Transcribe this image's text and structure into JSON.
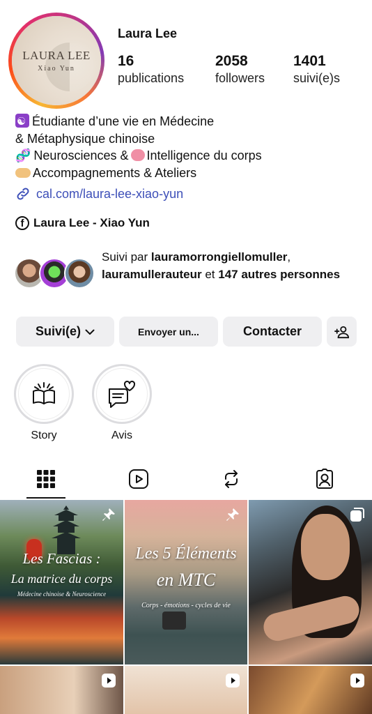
{
  "profile": {
    "name": "Laura Lee",
    "avatar_text": "LAURA LEE",
    "avatar_subtext": "Xiao Yun"
  },
  "stats": [
    {
      "value": "16",
      "label": "publications"
    },
    {
      "value": "2058",
      "label": "followers"
    },
    {
      "value": "1401",
      "label": "suivi(e)s"
    }
  ],
  "bio": {
    "line1": "Étudiante d’une vie en Médecine",
    "line2": "& Métaphysique chinoise",
    "line3a": "Neurosciences &",
    "line3b": "Intelligence du corps",
    "line4": "Accompagnements & Ateliers"
  },
  "link": {
    "text": "cal.com/laura-lee-xiao-yun"
  },
  "facebook": {
    "text": "Laura Lee - Xiao Yun"
  },
  "followed_by": {
    "prefix": "Suivi par",
    "user1": "lauramorrongiellomuller",
    "user2": "lauramullerauteur",
    "middle": "et",
    "others": "147 autres personnes"
  },
  "buttons": {
    "follow": "Suivi(e)",
    "message": "Envoyer un...",
    "contact": "Contacter"
  },
  "highlights": [
    {
      "label": "Story",
      "icon": "open-book-icon"
    },
    {
      "label": "Avis",
      "icon": "speech-heart-icon"
    }
  ],
  "tabs": [
    "grid-icon",
    "reels-icon",
    "reposts-icon",
    "tagged-icon"
  ],
  "posts": [
    {
      "title1": "Les Fascias :",
      "title2": "La matrice du corps",
      "subtitle": "Médecine chinoise & Neuroscience",
      "badge": "pin-icon"
    },
    {
      "title1": "Les 5 Éléments",
      "title2": "en MTC",
      "subtitle": "Corps - émotions - cycles de vie",
      "badge": "pin-icon"
    },
    {
      "badge": "carousel-icon"
    },
    {
      "badge": "reel-icon"
    },
    {
      "badge": "reel-icon"
    },
    {
      "badge": "reel-icon"
    }
  ],
  "colors": {
    "link": "#3d4fb8",
    "button_bg": "#efeff1",
    "text": "#111111"
  }
}
